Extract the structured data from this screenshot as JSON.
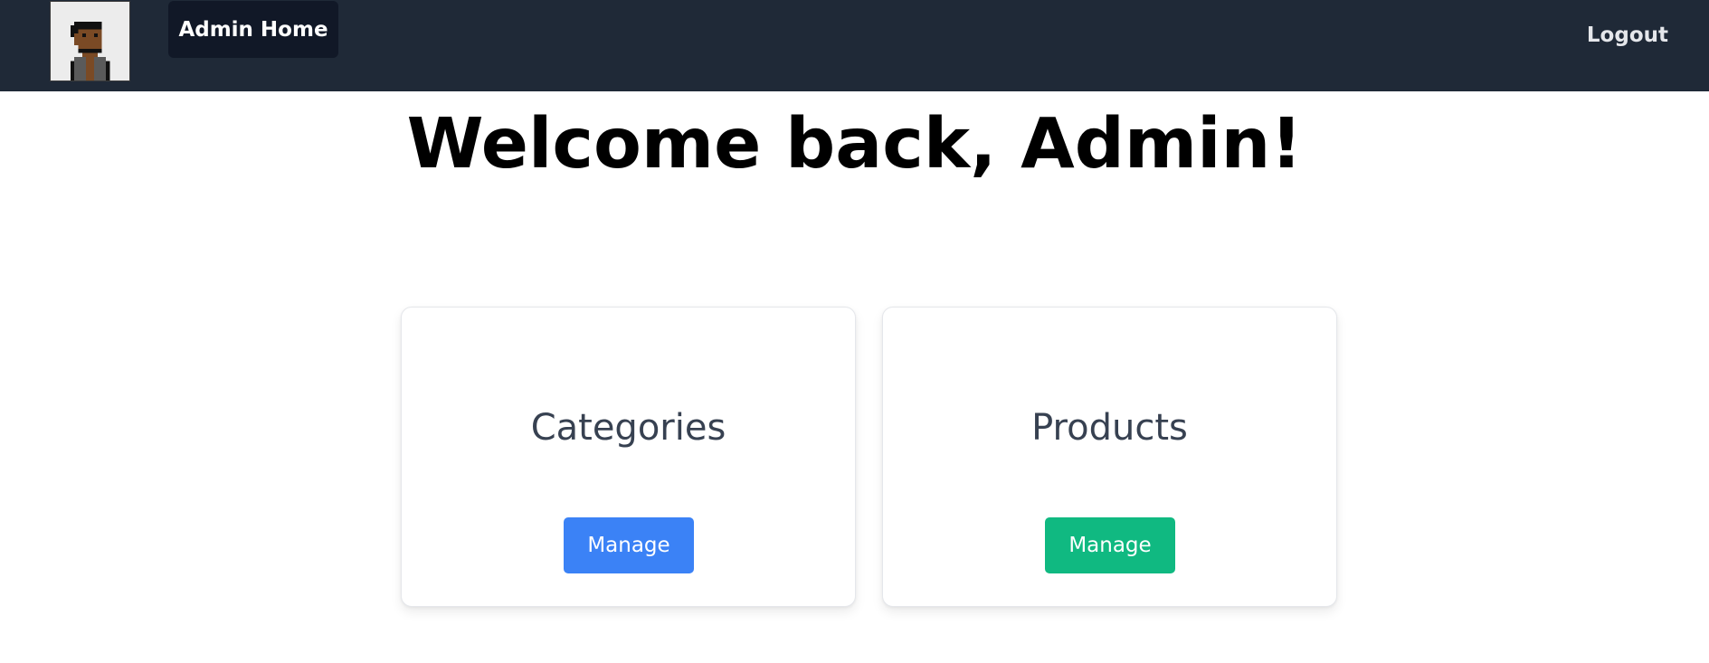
{
  "navbar": {
    "avatar_icon": "pixel-person-avatar",
    "home_label": "Admin Home",
    "logout_label": "Logout",
    "background": "#1f2937"
  },
  "main": {
    "welcome": "Welcome back, Admin!"
  },
  "cards": [
    {
      "title": "Categories",
      "button_label": "Manage",
      "button_color": "#3b82f6"
    },
    {
      "title": "Products",
      "button_label": "Manage",
      "button_color": "#10b981"
    }
  ]
}
